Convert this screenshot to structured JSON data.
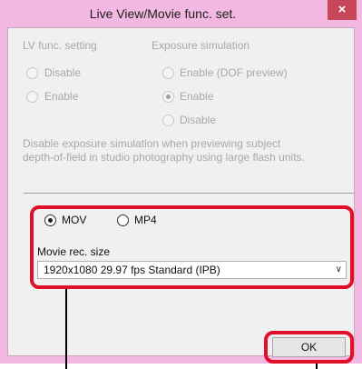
{
  "window": {
    "title": "Live View/Movie func. set.",
    "close_glyph": "×"
  },
  "lv_func": {
    "heading": "LV func. setting",
    "options": [
      {
        "label": "Disable",
        "selected": false,
        "enabled": false
      },
      {
        "label": "Enable",
        "selected": false,
        "enabled": false
      }
    ]
  },
  "exposure_sim": {
    "heading": "Exposure simulation",
    "options": [
      {
        "label": "Enable (DOF preview)",
        "selected": false,
        "enabled": false
      },
      {
        "label": "Enable",
        "selected": true,
        "enabled": false
      },
      {
        "label": "Disable",
        "selected": false,
        "enabled": false
      }
    ],
    "note_line1": "Disable exposure simulation when previewing subject",
    "note_line2": "depth-of-field in studio photography using large flash units."
  },
  "movie": {
    "format_options": [
      {
        "label": "MOV",
        "selected": true
      },
      {
        "label": "MP4",
        "selected": false
      }
    ],
    "rec_size_label": "Movie rec. size",
    "rec_size_value": "1920x1080  29.97 fps Standard (IPB)"
  },
  "buttons": {
    "ok_label": "OK"
  },
  "colors": {
    "title_bar": "#f2b8e1",
    "close_button": "#c7465a",
    "highlight": "#e0102a"
  }
}
